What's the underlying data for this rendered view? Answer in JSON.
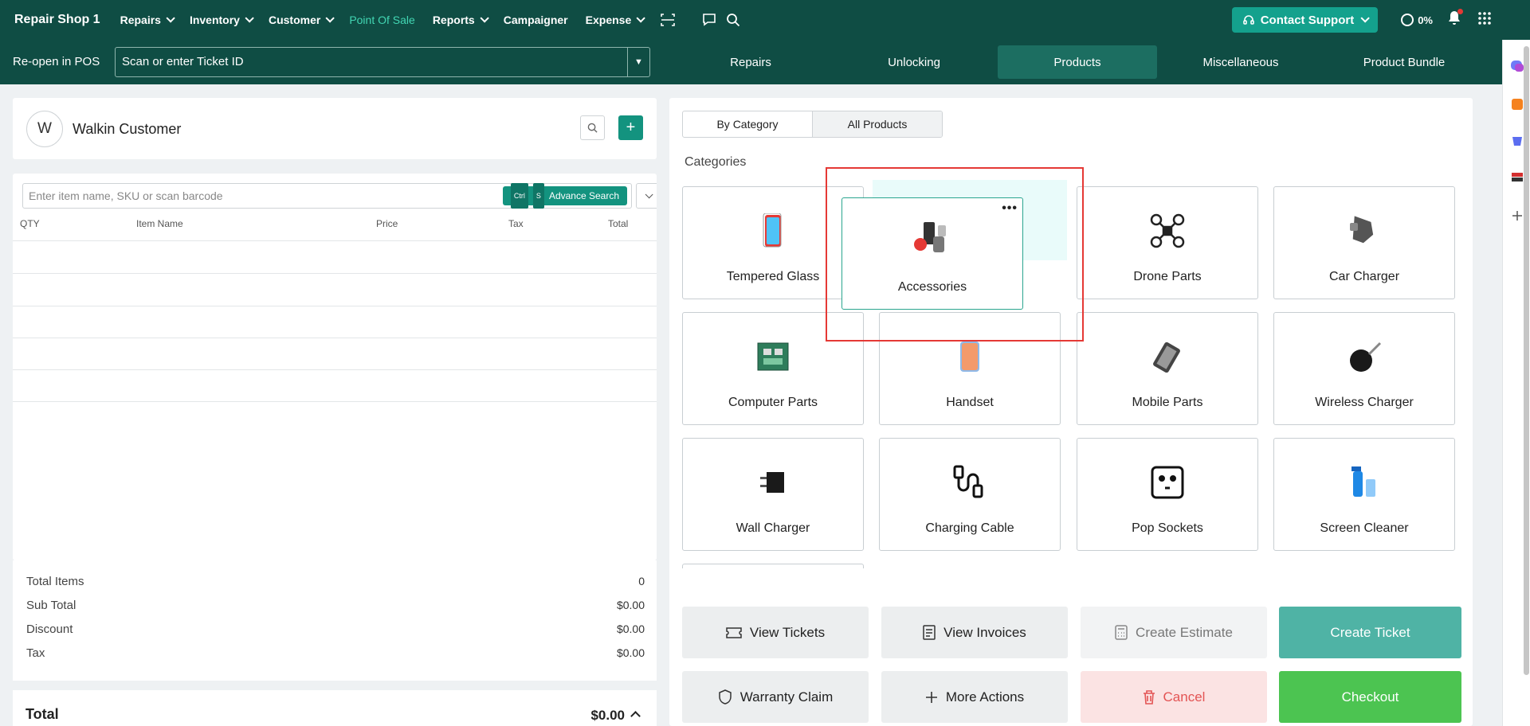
{
  "nav": {
    "brand": "Repair Shop 1",
    "items": [
      {
        "label": "Repairs",
        "dropdown": true
      },
      {
        "label": "Inventory",
        "dropdown": true
      },
      {
        "label": "Customer",
        "dropdown": true
      },
      {
        "label": "Point Of Sale",
        "dropdown": false,
        "active": true
      },
      {
        "label": "Reports",
        "dropdown": true
      },
      {
        "label": "Campaigner",
        "dropdown": false
      },
      {
        "label": "Expense",
        "dropdown": true
      }
    ],
    "support_label": "Contact Support",
    "progress_label": "0%",
    "progress_value": 0
  },
  "subbar": {
    "reopen_label": "Re-open in POS",
    "ticket_placeholder": "Scan or enter Ticket ID",
    "tabs": [
      "Repairs",
      "Unlocking",
      "Products",
      "Miscellaneous",
      "Product Bundle"
    ],
    "active_tab": "Products"
  },
  "customer": {
    "initial": "W",
    "name": "Walkin Customer"
  },
  "items": {
    "search_placeholder": "Enter item name, SKU or scan barcode",
    "shortcut_ctrl": "Ctrl",
    "shortcut_key": "S",
    "advance_search_label": "Advance Search",
    "columns": [
      "QTY",
      "Item Name",
      "Price",
      "Tax",
      "Total"
    ]
  },
  "totals": {
    "rows": [
      {
        "label": "Total Items",
        "value": "0"
      },
      {
        "label": "Sub Total",
        "value": "$0.00"
      },
      {
        "label": "Discount",
        "value": "$0.00"
      },
      {
        "label": "Tax",
        "value": "$0.00"
      }
    ],
    "grand_label": "Total",
    "grand_value": "$0.00"
  },
  "products": {
    "view_toggle": [
      "By Category",
      "All Products"
    ],
    "categories_title": "Categories",
    "categories": [
      {
        "label": "Tempered Glass",
        "icon": "tempered-glass-icon"
      },
      {
        "label": "Drone Parts",
        "icon": "drone-icon"
      },
      {
        "label": "Car Charger",
        "icon": "car-charger-icon"
      },
      {
        "label": "Computer Parts",
        "icon": "circuit-board-icon"
      },
      {
        "label": "Handset",
        "icon": "phone-icon"
      },
      {
        "label": "Mobile Parts",
        "icon": "phone-parts-icon"
      },
      {
        "label": "Wireless Charger",
        "icon": "wireless-charger-icon"
      },
      {
        "label": "Wall Charger",
        "icon": "wall-charger-icon"
      },
      {
        "label": "Charging Cable",
        "icon": "cable-icon"
      },
      {
        "label": "Pop Sockets",
        "icon": "socket-icon"
      },
      {
        "label": "Screen Cleaner",
        "icon": "spray-bottle-icon"
      }
    ],
    "dragging": {
      "label": "Accessories",
      "icon": "accessories-icon",
      "menu": "•••"
    }
  },
  "actions": {
    "view_tickets": "View Tickets",
    "view_invoices": "View Invoices",
    "create_estimate": "Create Estimate",
    "create_ticket": "Create Ticket",
    "warranty_claim": "Warranty Claim",
    "more_actions": "More Actions",
    "cancel": "Cancel",
    "checkout": "Checkout"
  },
  "colors": {
    "nav_bg": "#0f4d44",
    "accent": "#13937f",
    "active_nav": "#42d6b3",
    "checkout": "#4cc451",
    "cancel": "#e35454",
    "highlight_box": "#e53935"
  }
}
